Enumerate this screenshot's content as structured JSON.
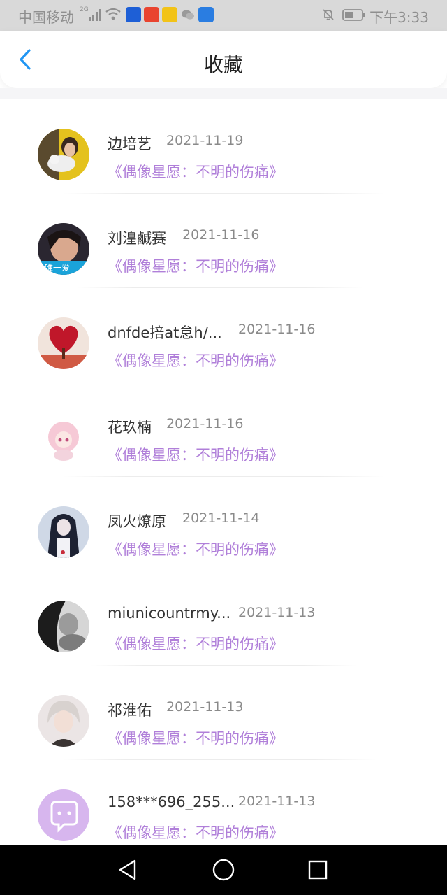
{
  "status_bar": {
    "carrier": "中国移动",
    "network": "2G",
    "time": "下午3:33"
  },
  "header": {
    "title": "收藏"
  },
  "colors": {
    "accent_blue": "#2196f3",
    "title_purple": "#b07fd9",
    "text_dark": "#333333",
    "text_gray": "#8a8a8a"
  },
  "favorites": [
    {
      "name": "边培艺",
      "date": "2021-11-19",
      "title": "《偶像星愿：不明的伤痛》",
      "avatar_icon": "girl-with-cat-avatar"
    },
    {
      "name": "刘湟鹹赛",
      "date": "2021-11-16",
      "title": "《偶像星愿：不明的伤痛》",
      "avatar_icon": "girl-portrait-avatar",
      "avatar_caption": "唯一爱"
    },
    {
      "name": "dnfde掊at怠h/...",
      "date": "2021-11-16",
      "title": "《偶像星愿：不明的伤痛》",
      "avatar_icon": "heart-tree-avatar"
    },
    {
      "name": "花玖楠",
      "date": "2021-11-16",
      "title": "《偶像星愿：不明的伤痛》",
      "avatar_icon": "anime-pink-girl-avatar"
    },
    {
      "name": "凤火燎原",
      "date": "2021-11-14",
      "title": "《偶像星愿：不明的伤痛》",
      "avatar_icon": "anime-dark-hair-avatar"
    },
    {
      "name": "miunicountrmy...",
      "date": "2021-11-13",
      "title": "《偶像星愿：不明的伤痛》",
      "avatar_icon": "monochrome-portrait-avatar"
    },
    {
      "name": "祁淮佑",
      "date": "2021-11-13",
      "title": "《偶像星愿：不明的伤痛》",
      "avatar_icon": "anime-white-hair-boy-avatar"
    },
    {
      "name": "158***696_255...",
      "date": "2021-11-13",
      "title": "《偶像星愿：不明的伤痛》",
      "avatar_icon": "default-chat-bubble-avatar"
    }
  ]
}
